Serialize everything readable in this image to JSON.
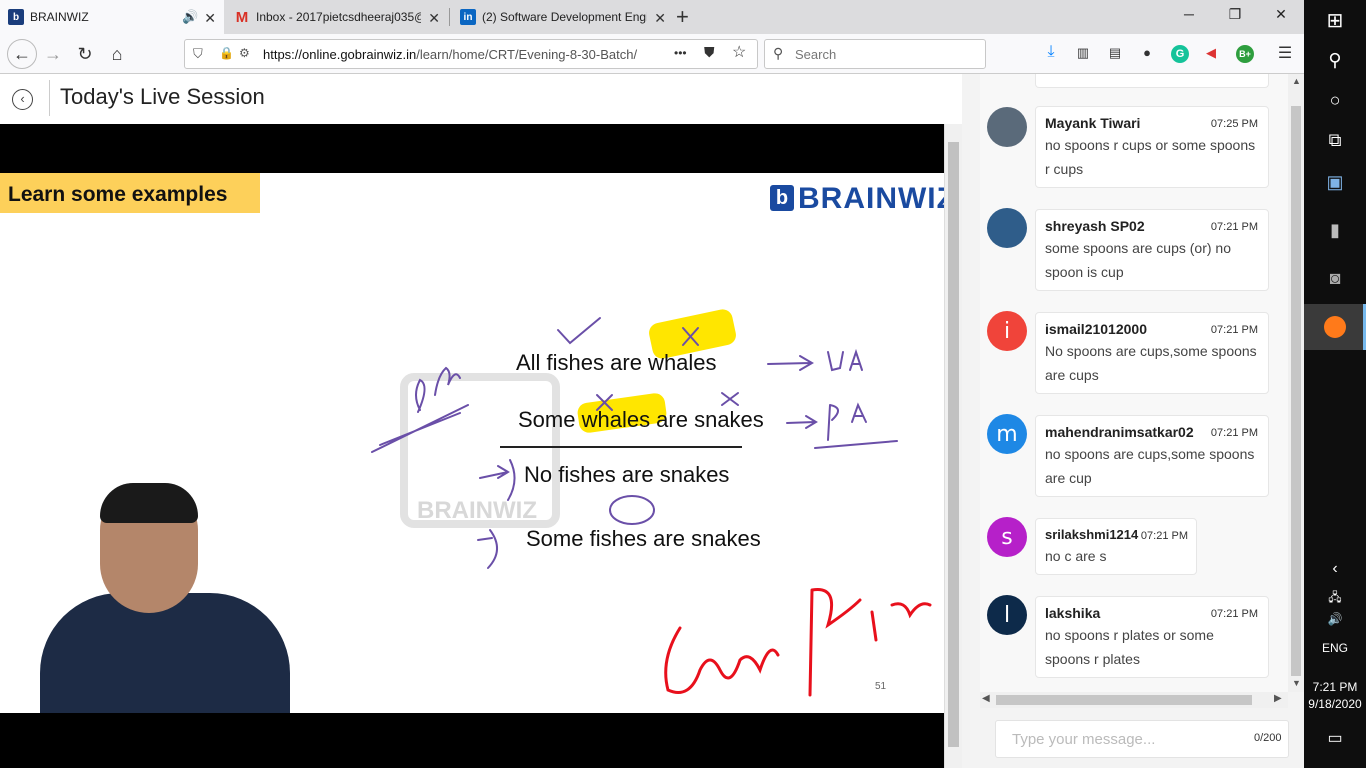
{
  "browser": {
    "tabs": [
      {
        "title": "BRAINWIZ",
        "favicon": "brainwiz-logo",
        "active": true
      },
      {
        "title": "Inbox - 2017pietcsdheeraj035@",
        "favicon": "gmail-icon",
        "active": false
      },
      {
        "title": "(2) Software Development Engi",
        "favicon": "linkedin-icon",
        "active": false
      }
    ],
    "new_tab": "+",
    "url_host": "https://online.gobrainwiz.in",
    "url_path": "/learn/home/CRT/Evening-8-30-Batch/",
    "search_placeholder": "Search",
    "url_more": "•••"
  },
  "page": {
    "title": "Today's Live Session"
  },
  "slide": {
    "banner": "Learn some examples",
    "logo_text": "BRAINWIZ",
    "watermark": "BRAINWIZ",
    "statements": [
      "All fishes are whales",
      "Some whales are snakes",
      "No fishes are snakes",
      "Some fishes are snakes"
    ],
    "page_number": "51"
  },
  "chat": {
    "messages": [
      {
        "user": "Mayank Tiwari",
        "time": "07:25 PM",
        "text": "no spoons r cups or some spoons r cups",
        "avatar": "photo",
        "color": "#5a6a7a"
      },
      {
        "user": "shreyash SP02",
        "time": "07:21 PM",
        "text": "some spoons are cups (or) no spoon is cup",
        "avatar": "photo",
        "color": "#2f5d8a"
      },
      {
        "user": "ismail21012000",
        "time": "07:21 PM",
        "text": "No spoons are cups,some spoons are cups",
        "avatar": "i",
        "color": "#f0443a"
      },
      {
        "user": "mahendranimsatkar02",
        "time": "07:21 PM",
        "text": "no spoons are cups,some spoons are cup",
        "avatar": "m",
        "color": "#1e88e5"
      },
      {
        "user": "srilakshmi1214",
        "time": "07:21 PM",
        "text": "no c are s",
        "avatar": "s",
        "color": "#b620c9"
      },
      {
        "user": "lakshika",
        "time": "07:21 PM",
        "text": "no spoons r plates or some spoons r plates",
        "avatar": "l",
        "color": "#0d2a4a"
      }
    ],
    "input_placeholder": "Type your message...",
    "char_counter": "0/200"
  },
  "taskbar": {
    "language": "ENG",
    "time": "7:21 PM",
    "date": "9/18/2020"
  }
}
